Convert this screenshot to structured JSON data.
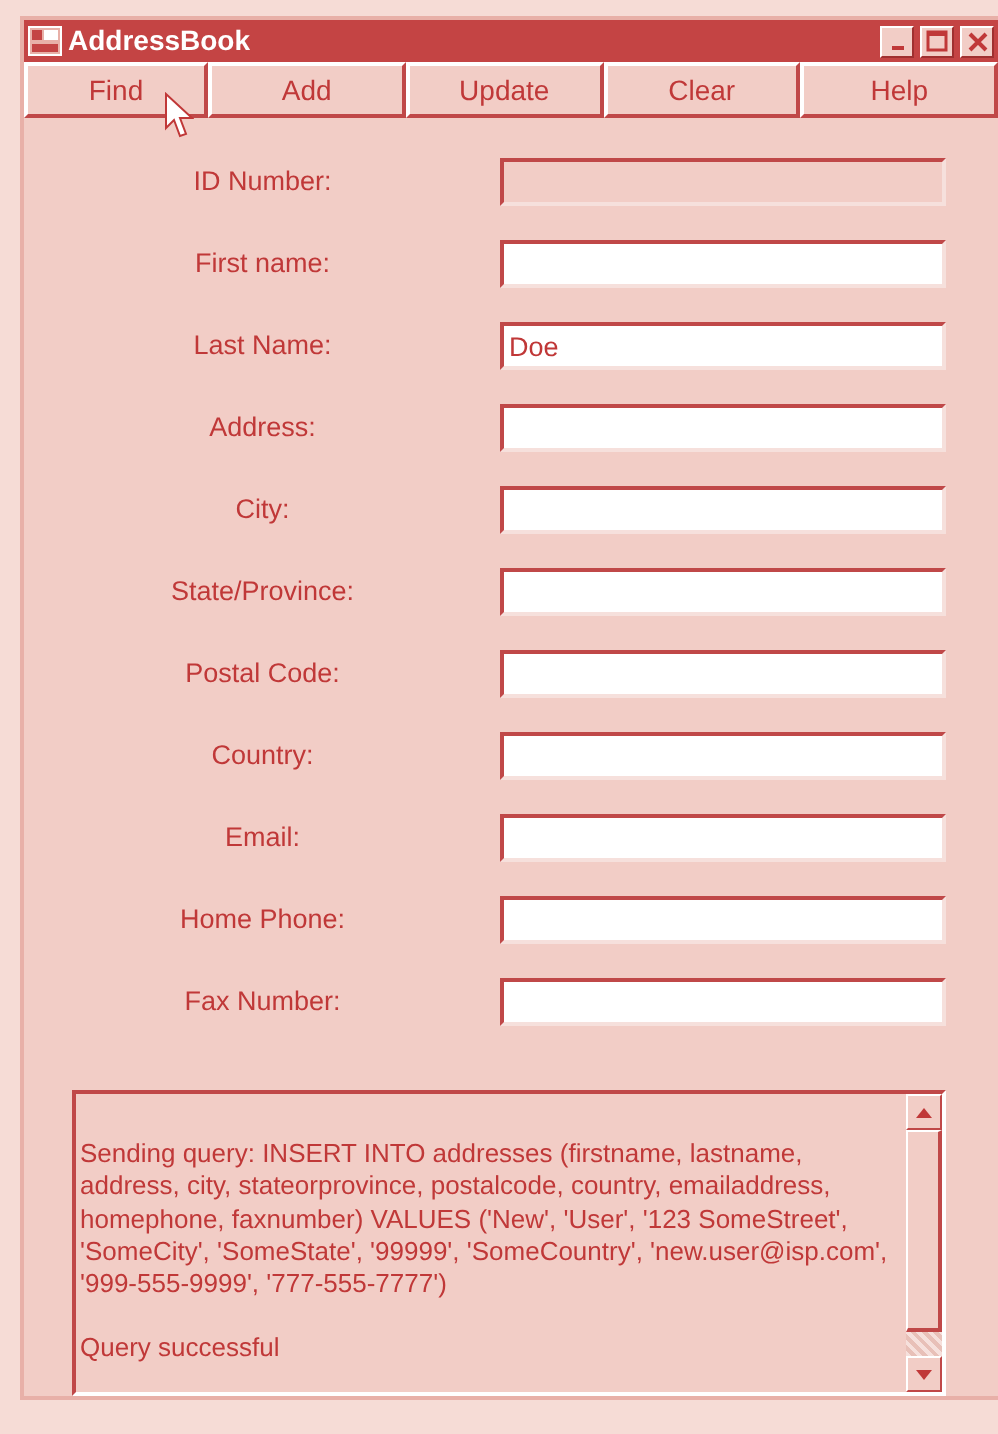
{
  "window": {
    "title": "AddressBook"
  },
  "toolbar": [
    {
      "label": "Find"
    },
    {
      "label": "Add"
    },
    {
      "label": "Update"
    },
    {
      "label": "Clear"
    },
    {
      "label": "Help"
    }
  ],
  "fields": [
    {
      "label": "ID Number:",
      "disabled": true
    },
    {
      "label": "First name:",
      "disabled": false
    },
    {
      "label": "Last Name:",
      "value": "Doe",
      "disabled": false
    },
    {
      "label": "Address:",
      "disabled": false
    },
    {
      "label": "City:",
      "disabled": false
    },
    {
      "label": "State/Province:",
      "disabled": false
    },
    {
      "label": "Postal Code:",
      "disabled": false
    },
    {
      "label": "Country:",
      "disabled": false
    },
    {
      "label": "Email:",
      "disabled": false
    },
    {
      "label": "Home Phone:",
      "disabled": false
    },
    {
      "label": "Fax Number:",
      "disabled": false
    }
  ],
  "log": [
    "Sending query: INSERT INTO addresses (firstname, lastname, address, city, stateorprovince, postalcode, country, emailaddress, homephone, faxnumber) VALUES ('New', 'User', '123 SomeStreet', 'SomeCity', 'SomeState', '99999', 'SomeCountry', 'new.user@isp.com', '999-555-9999', '777-555-7777')",
    "Query successful"
  ]
}
